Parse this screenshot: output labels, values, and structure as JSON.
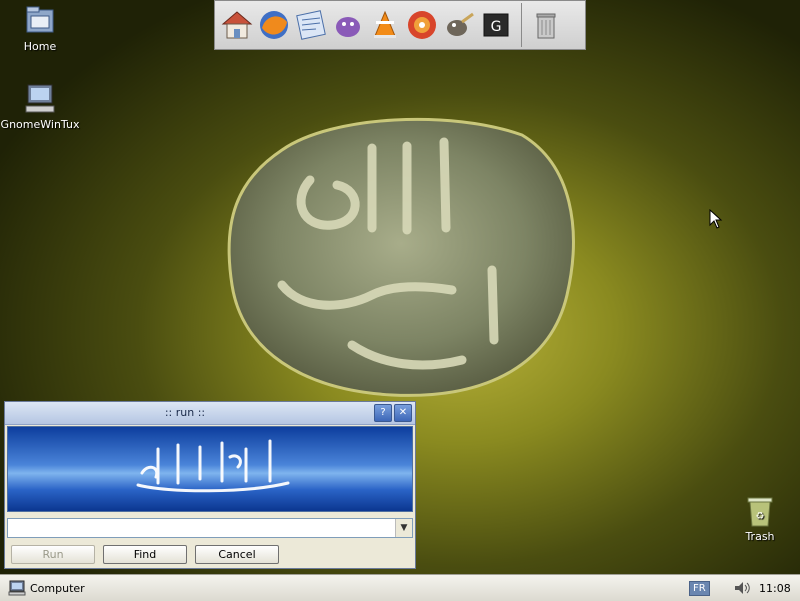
{
  "desktop": {
    "icons": [
      {
        "label": "Home",
        "icon": "home-folder-icon"
      },
      {
        "label": "GnomeWinTux",
        "icon": "computer-icon"
      },
      {
        "label": "Trash",
        "icon": "trash-icon"
      }
    ]
  },
  "dock": {
    "items": [
      "home-icon",
      "firefox-icon",
      "mail-icon",
      "pidgin-icon",
      "vlc-icon",
      "media-player-icon",
      "gimp-icon",
      "terminal-icon",
      "trash-can-icon"
    ]
  },
  "run_dialog": {
    "title": ":: run ::",
    "help": "?",
    "close": "✕",
    "command_value": "",
    "buttons": {
      "run": "Run",
      "find": "Find",
      "cancel": "Cancel"
    }
  },
  "panel": {
    "start_label": "Computer",
    "keyboard_layout": "FR",
    "clock": "11:08"
  },
  "colors": {
    "accent": "#3d67b8",
    "banner": "#2a63c6"
  }
}
